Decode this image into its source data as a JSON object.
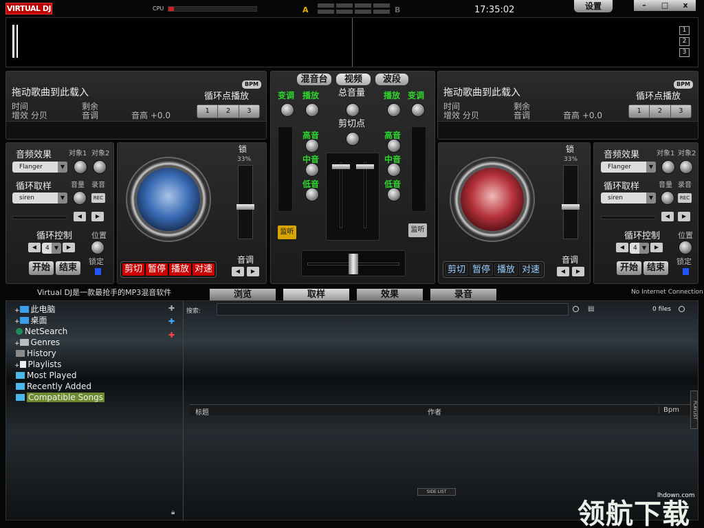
{
  "topbar": {
    "logo": "VIRTUAL DJ",
    "cpu_label": "CPU",
    "a_label": "A",
    "b_label": "B",
    "clock": "17:35:02",
    "settings": "设置",
    "minimize": "–",
    "maximize": "□",
    "close": "x",
    "zoom": [
      "1",
      "2",
      "3"
    ]
  },
  "decks": [
    {
      "title": "拖动歌曲到此载入",
      "time_label": "时间",
      "gain_label": "增效 分贝",
      "remain_label": "剩余",
      "pitch_label": "音调",
      "key_label": "音高 +0.0",
      "loop_label": "循环点播放",
      "bpm": "BPM",
      "cues": [
        "1",
        "2",
        "3"
      ],
      "effect_label": "音频效果",
      "obj1": "对象1",
      "obj2": "对象2",
      "effect_value": "Flanger",
      "sample_label": "循环取样",
      "vol_label": "音量",
      "rec_label": "录音",
      "sample_value": "siren",
      "rec": "REC",
      "loopctl_label": "循环控制",
      "loop_value": "4",
      "pos_label": "位置",
      "start": "开始",
      "end": "结束",
      "lockl": "锁定",
      "lock": "锁",
      "lock_pct": "33%",
      "pitch2": "音调",
      "accent": "#3a6bb5",
      "transport": [
        "剪切",
        "暂停",
        "播放",
        "对速"
      ]
    },
    {
      "title": "拖动歌曲到此载入",
      "time_label": "时间",
      "gain_label": "增效 分贝",
      "remain_label": "剩余",
      "pitch_label": "音调",
      "key_label": "音高 +0.0",
      "loop_label": "循环点播放",
      "bpm": "BPM",
      "cues": [
        "1",
        "2",
        "3"
      ],
      "effect_label": "音频效果",
      "obj1": "对象1",
      "obj2": "对象2",
      "effect_value": "Flanger",
      "sample_label": "循环取样",
      "vol_label": "音量",
      "rec_label": "录音",
      "sample_value": "siren",
      "rec": "REC",
      "loopctl_label": "循环控制",
      "loop_value": "4",
      "pos_label": "位置",
      "start": "开始",
      "end": "结束",
      "lockl": "锁定",
      "lock": "锁",
      "lock_pct": "33%",
      "pitch2": "音调",
      "accent": "#b5313a",
      "transport": [
        "剪切",
        "暂停",
        "播放",
        "对速"
      ]
    }
  ],
  "mixer": {
    "tabs": [
      "混音台",
      "视频",
      "波段"
    ],
    "left": [
      "变调",
      "播放"
    ],
    "right": [
      "播放",
      "变调"
    ],
    "master": "总音量",
    "cut": "剪切点",
    "eq": [
      "高音",
      "中音",
      "低音"
    ],
    "listen": "监听"
  },
  "status": {
    "caption": "Virtual DJ是一款最抢手的MP3混音软件",
    "net": "No Internet Connection"
  },
  "browser": {
    "tabs": [
      "浏览",
      "取样",
      "效果",
      "录音"
    ],
    "search_label": "搜索:",
    "files": "0 files",
    "tree": [
      "此电脑",
      "桌面",
      "NetSearch",
      "Genres",
      "History",
      "Playlists",
      "Most Played",
      "Recently Added",
      "Compatible Songs"
    ],
    "columns": [
      "标题",
      "作者",
      "Bpm"
    ],
    "playlist": "PLAYLIST",
    "sidelist": "SIDE LIST"
  },
  "watermark": {
    "site": "lhdown.com",
    "text": "领航下载"
  }
}
